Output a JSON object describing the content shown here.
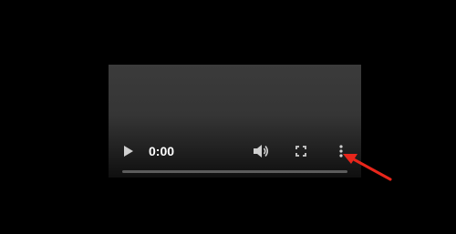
{
  "player": {
    "current_time": "0:00",
    "progress_fraction": 0.0
  },
  "icons": {
    "play": "play-icon",
    "volume": "volume-icon",
    "fullscreen": "fullscreen-icon",
    "more": "more-options-icon",
    "annotation": "red-arrow-icon"
  },
  "colors": {
    "background": "#000000",
    "controls": "#cfcfcf",
    "arrow": "#e8261b"
  }
}
